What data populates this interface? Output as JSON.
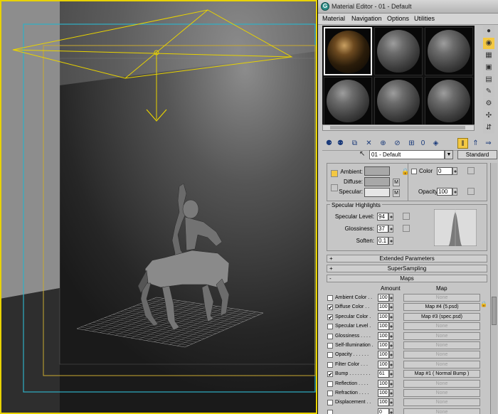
{
  "medit": {
    "title": "Material Editor - 01 - Default",
    "menu": [
      "Material",
      "Navigation",
      "Options",
      "Utilities"
    ],
    "material_name": "01 - Default",
    "material_type": "Standard",
    "basic": {
      "ambient_label": "Ambient:",
      "diffuse_label": "Diffuse:",
      "specular_label": "Specular:",
      "m_label": "M",
      "color_label": "Color",
      "color_value": "0",
      "opacity_label": "Opacity:",
      "opacity_value": "100",
      "ambient_color": "#a8a8a8",
      "diffuse_color": "#a8a8a8",
      "specular_color": "#e6e6e6"
    },
    "specular_highlights": {
      "title": "Specular Highlights",
      "level_label": "Specular Level:",
      "level_value": "94",
      "glossiness_label": "Glossiness:",
      "glossiness_value": "37",
      "soften_label": "Soften:",
      "soften_value": "0.1"
    },
    "rollouts": {
      "extended": "Extended Parameters",
      "supersampling": "SuperSampling",
      "maps": "Maps"
    },
    "maps": {
      "amount_header": "Amount",
      "map_header": "Map",
      "rows": [
        {
          "name": "Ambient Color . .",
          "checked": false,
          "amount": "100",
          "map": "None"
        },
        {
          "name": "Diffuse Color . .",
          "checked": true,
          "amount": "100",
          "map": "Map #4 (5.psd)"
        },
        {
          "name": "Specular Color .",
          "checked": true,
          "amount": "100",
          "map": "Map #3 (spec.psd)"
        },
        {
          "name": "Specular Level .",
          "checked": false,
          "amount": "100",
          "map": "None"
        },
        {
          "name": "Glossiness . . . .",
          "checked": false,
          "amount": "100",
          "map": "None"
        },
        {
          "name": "Self-Illumination .",
          "checked": false,
          "amount": "100",
          "map": "None"
        },
        {
          "name": "Opacity . . . . . .",
          "checked": false,
          "amount": "100",
          "map": "None"
        },
        {
          "name": "Filter Color . . .",
          "checked": false,
          "amount": "100",
          "map": "None"
        },
        {
          "name": "Bump . . . . . . . .",
          "checked": true,
          "amount": "61",
          "map": "Map #1  ( Normal Bump )"
        },
        {
          "name": "Reflection . . . .",
          "checked": false,
          "amount": "100",
          "map": "None"
        },
        {
          "name": "Refraction . . . .",
          "checked": false,
          "amount": "100",
          "map": "None"
        },
        {
          "name": "Displacement . .",
          "checked": false,
          "amount": "100",
          "map": "None"
        },
        {
          "name": "",
          "checked": false,
          "amount": "0",
          "map": "None"
        }
      ]
    }
  }
}
